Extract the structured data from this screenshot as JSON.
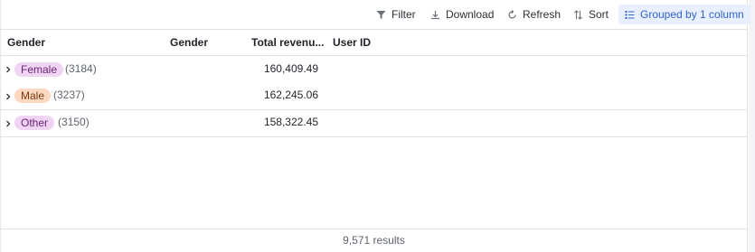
{
  "toolbar": {
    "filter_label": "Filter",
    "download_label": "Download",
    "refresh_label": "Refresh",
    "sort_label": "Sort",
    "grouped_label": "Grouped by 1 column",
    "accent_color": "#3461d1"
  },
  "table": {
    "columns": [
      "Gender",
      "Gender",
      "Total revenu...",
      "User ID"
    ],
    "groups": [
      {
        "label": "Female",
        "count": "(3184)",
        "revenue": "160,409.49",
        "pill_bg": "#f0d4f3",
        "pill_fg": "#6b2475"
      },
      {
        "label": "Male",
        "count": "(3237)",
        "revenue": "162,245.06",
        "pill_bg": "#fbd8bf",
        "pill_fg": "#7a3a10"
      },
      {
        "label": "Other",
        "count": "(3150)",
        "revenue": "158,322.45",
        "pill_bg": "#f0d4f3",
        "pill_fg": "#6b2475"
      }
    ]
  },
  "footer": {
    "results_label": "9,571 results"
  }
}
